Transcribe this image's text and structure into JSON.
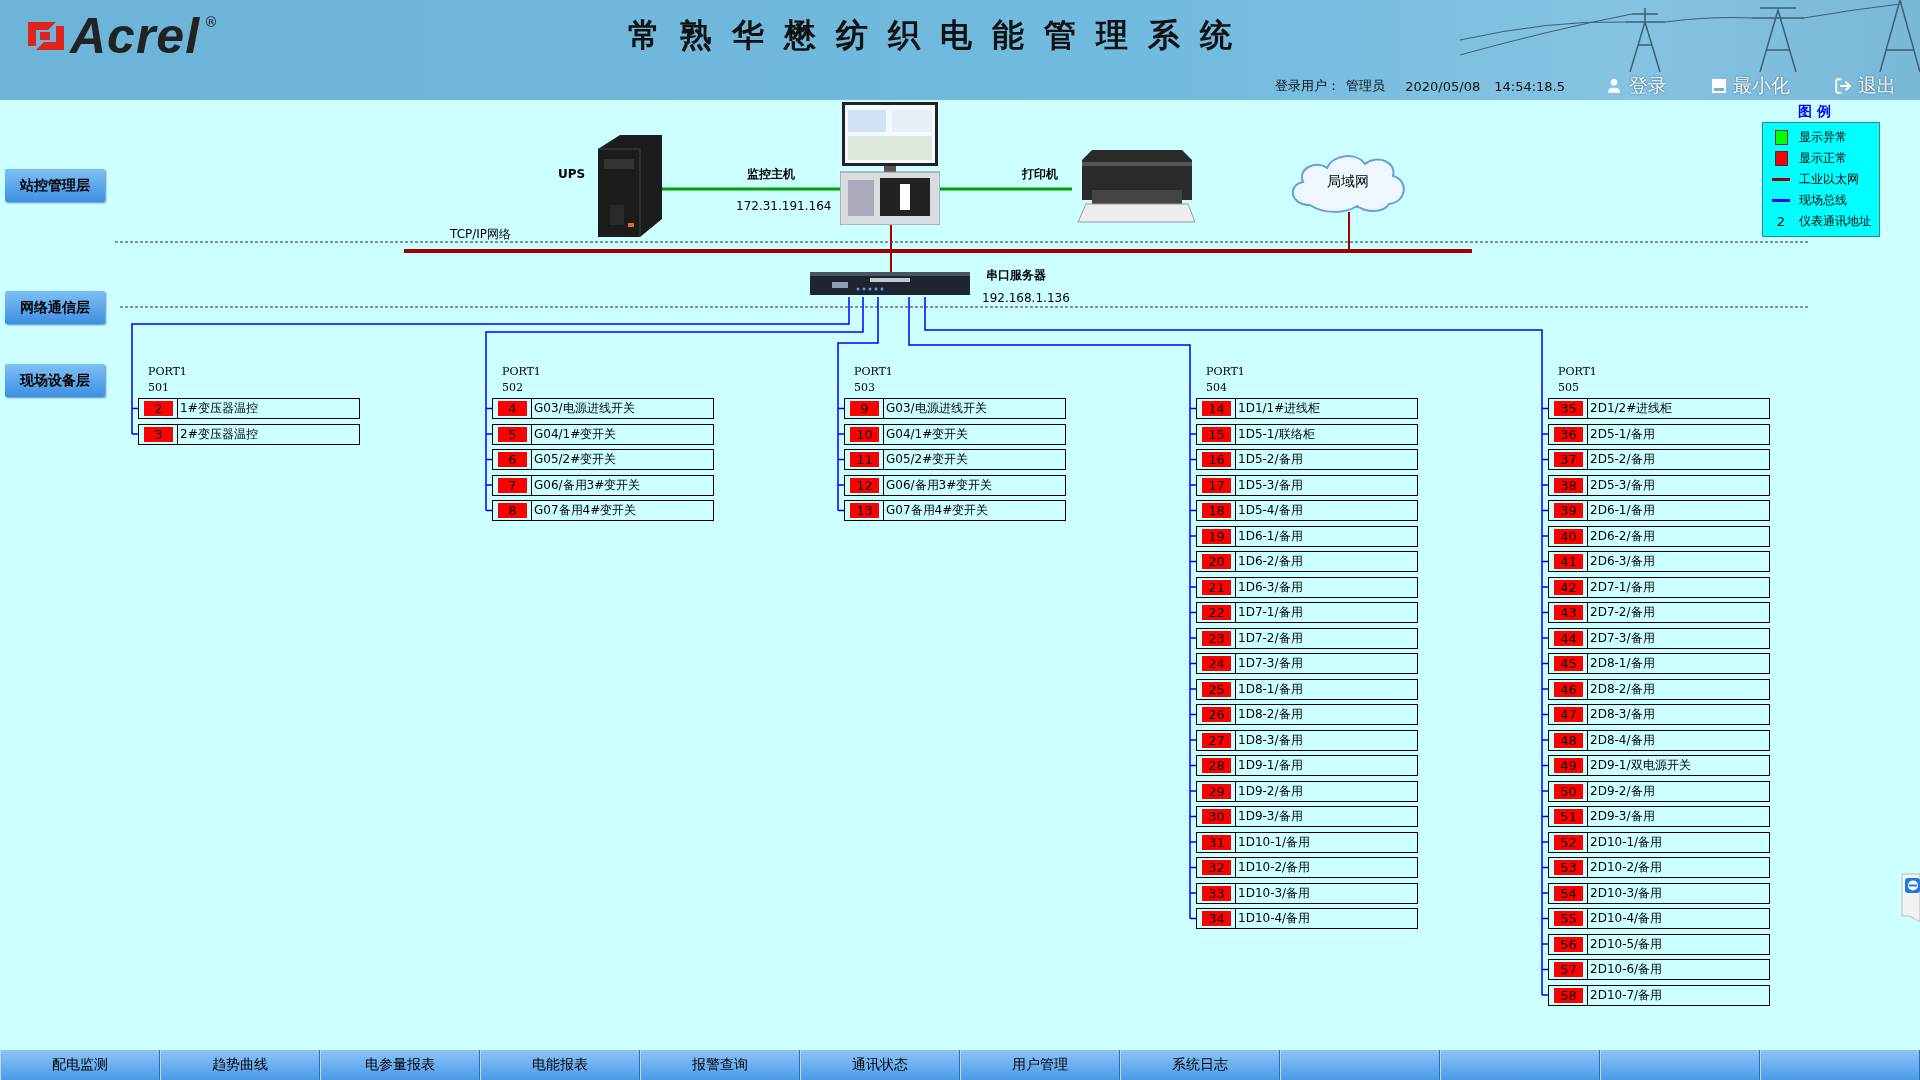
{
  "header": {
    "logo": "Acrel",
    "logo_mark": "®",
    "title": "常熟华懋纺织电能管理系统",
    "user_label": "登录用户：",
    "user": "管理员",
    "date": "2020/05/08",
    "time": "14:54:18.5",
    "buttons": [
      {
        "kind": "login",
        "label": "登录"
      },
      {
        "kind": "minimize",
        "label": "最小化"
      },
      {
        "kind": "exit",
        "label": "退出"
      }
    ]
  },
  "layers": [
    {
      "label": "站控管理层"
    },
    {
      "label": "网络通信层"
    },
    {
      "label": "现场设备层"
    }
  ],
  "network": {
    "ups": "UPS",
    "host": "监控主机",
    "host_ip": "172.31.191.164",
    "printer": "打印机",
    "lan": "局域网",
    "tcpip": "TCP/IP网络",
    "server": "串口服务器",
    "server_ip": "192.168.1.136"
  },
  "legend": {
    "title": "图 例",
    "items": [
      {
        "kind": "square",
        "color": "#00ff00",
        "label": "显示异常"
      },
      {
        "kind": "square",
        "color": "#ff0000",
        "label": "显示正常"
      },
      {
        "kind": "line",
        "color": "#990000",
        "label": "工业以太网"
      },
      {
        "kind": "line",
        "color": "#0000ff",
        "label": "现场总线"
      },
      {
        "kind": "number",
        "symbol": "2",
        "label": "仪表通讯地址"
      }
    ]
  },
  "ports": [
    {
      "port": "PORT1",
      "number": "501",
      "devices": [
        {
          "address": "2",
          "name": "1#变压器温控",
          "color": "#ff0000"
        },
        {
          "address": "3",
          "name": "2#变压器温控",
          "color": "#ff0000"
        }
      ]
    },
    {
      "port": "PORT1",
      "number": "502",
      "devices": [
        {
          "address": "4",
          "name": "G03/电源进线开关",
          "color": "#ff0000"
        },
        {
          "address": "5",
          "name": "G04/1#变开关",
          "color": "#ff0000"
        },
        {
          "address": "6",
          "name": "G05/2#变开关",
          "color": "#ff0000"
        },
        {
          "address": "7",
          "name": "G06/备用3#变开关",
          "color": "#ff0000"
        },
        {
          "address": "8",
          "name": "G07备用4#变开关",
          "color": "#ff0000"
        }
      ]
    },
    {
      "port": "PORT1",
      "number": "503",
      "devices": [
        {
          "address": "9",
          "name": "G03/电源进线开关",
          "color": "#ff0000"
        },
        {
          "address": "10",
          "name": "G04/1#变开关",
          "color": "#ff0000"
        },
        {
          "address": "11",
          "name": "G05/2#变开关",
          "color": "#ff0000"
        },
        {
          "address": "12",
          "name": "G06/备用3#变开关",
          "color": "#ff0000"
        },
        {
          "address": "13",
          "name": "G07备用4#变开关",
          "color": "#ff0000"
        }
      ]
    },
    {
      "port": "PORT1",
      "number": "504",
      "devices": [
        {
          "address": "14",
          "name": "1D1/1#进线柜",
          "color": "#ff0000"
        },
        {
          "address": "15",
          "name": "1D5-1/联络柜",
          "color": "#ff0000"
        },
        {
          "address": "16",
          "name": "1D5-2/备用",
          "color": "#ff0000"
        },
        {
          "address": "17",
          "name": "1D5-3/备用",
          "color": "#ff0000"
        },
        {
          "address": "18",
          "name": "1D5-4/备用",
          "color": "#ff0000"
        },
        {
          "address": "19",
          "name": "1D6-1/备用",
          "color": "#ff0000"
        },
        {
          "address": "20",
          "name": "1D6-2/备用",
          "color": "#ff0000"
        },
        {
          "address": "21",
          "name": "1D6-3/备用",
          "color": "#ff0000"
        },
        {
          "address": "22",
          "name": "1D7-1/备用",
          "color": "#ff0000"
        },
        {
          "address": "23",
          "name": "1D7-2/备用",
          "color": "#ff0000"
        },
        {
          "address": "24",
          "name": "1D7-3/备用",
          "color": "#ff0000"
        },
        {
          "address": "25",
          "name": "1D8-1/备用",
          "color": "#ff0000"
        },
        {
          "address": "26",
          "name": "1D8-2/备用",
          "color": "#ff0000"
        },
        {
          "address": "27",
          "name": "1D8-3/备用",
          "color": "#ff0000"
        },
        {
          "address": "28",
          "name": "1D9-1/备用",
          "color": "#ff0000"
        },
        {
          "address": "29",
          "name": "1D9-2/备用",
          "color": "#ff0000"
        },
        {
          "address": "30",
          "name": "1D9-3/备用",
          "color": "#ff0000"
        },
        {
          "address": "31",
          "name": "1D10-1/备用",
          "color": "#ff0000"
        },
        {
          "address": "32",
          "name": "1D10-2/备用",
          "color": "#ff0000"
        },
        {
          "address": "33",
          "name": "1D10-3/备用",
          "color": "#ff0000"
        },
        {
          "address": "34",
          "name": "1D10-4/备用",
          "color": "#ff0000"
        }
      ]
    },
    {
      "port": "PORT1",
      "number": "505",
      "devices": [
        {
          "address": "35",
          "name": "2D1/2#进线柜",
          "color": "#ff0000"
        },
        {
          "address": "36",
          "name": "2D5-1/备用",
          "color": "#ff0000"
        },
        {
          "address": "37",
          "name": "2D5-2/备用",
          "color": "#ff0000"
        },
        {
          "address": "38",
          "name": "2D5-3/备用",
          "color": "#ff0000"
        },
        {
          "address": "39",
          "name": "2D6-1/备用",
          "color": "#ff0000"
        },
        {
          "address": "40",
          "name": "2D6-2/备用",
          "color": "#ff0000"
        },
        {
          "address": "41",
          "name": "2D6-3/备用",
          "color": "#ff0000"
        },
        {
          "address": "42",
          "name": "2D7-1/备用",
          "color": "#ff0000"
        },
        {
          "address": "43",
          "name": "2D7-2/备用",
          "color": "#ff0000"
        },
        {
          "address": "44",
          "name": "2D7-3/备用",
          "color": "#ff0000"
        },
        {
          "address": "45",
          "name": "2D8-1/备用",
          "color": "#ff0000"
        },
        {
          "address": "46",
          "name": "2D8-2/备用",
          "color": "#ff0000"
        },
        {
          "address": "47",
          "name": "2D8-3/备用",
          "color": "#ff0000"
        },
        {
          "address": "48",
          "name": "2D8-4/备用",
          "color": "#ff0000"
        },
        {
          "address": "49",
          "name": "2D9-1/双电源开关",
          "color": "#ff0000"
        },
        {
          "address": "50",
          "name": "2D9-2/备用",
          "color": "#ff0000"
        },
        {
          "address": "51",
          "name": "2D9-3/备用",
          "color": "#ff0000"
        },
        {
          "address": "52",
          "name": "2D10-1/备用",
          "color": "#ff0000"
        },
        {
          "address": "53",
          "name": "2D10-2/备用",
          "color": "#ff0000"
        },
        {
          "address": "54",
          "name": "2D10-3/备用",
          "color": "#ff0000"
        },
        {
          "address": "55",
          "name": "2D10-4/备用",
          "color": "#ff0000"
        },
        {
          "address": "56",
          "name": "2D10-5/备用",
          "color": "#ff0000"
        },
        {
          "address": "57",
          "name": "2D10-6/备用",
          "color": "#ff0000"
        },
        {
          "address": "58",
          "name": "2D10-7/备用",
          "color": "#ff0000"
        }
      ]
    }
  ],
  "nav": [
    {
      "label": "配电监测"
    },
    {
      "label": "趋势曲线"
    },
    {
      "label": "电参量报表"
    },
    {
      "label": "电能报表"
    },
    {
      "label": "报警查询"
    },
    {
      "label": "通讯状态"
    },
    {
      "label": "用户管理"
    },
    {
      "label": "系统日志"
    }
  ]
}
